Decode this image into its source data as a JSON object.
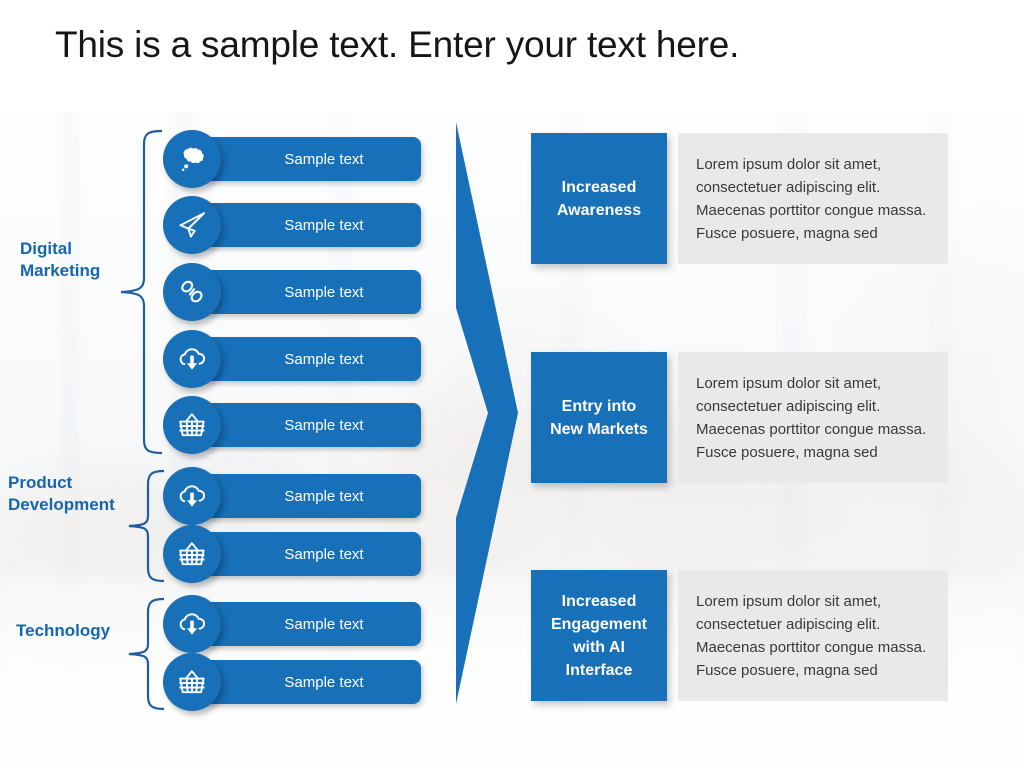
{
  "slide": {
    "title": "This is a sample text. Enter your text here.",
    "accent_blue": "#1770B8",
    "label_blue": "#1566AE",
    "brace_blue": "#1F5E9E",
    "body_gray": "#E9E9E9"
  },
  "categories": [
    {
      "label": "Digital\nMarketing",
      "name": "digital-marketing"
    },
    {
      "label": "Product\nDevelopment",
      "name": "product-development"
    },
    {
      "label": "Technology",
      "name": "technology"
    }
  ],
  "rows": [
    {
      "icon": "thought-cloud-icon",
      "text": "Sample text"
    },
    {
      "icon": "paper-plane-icon",
      "text": "Sample text"
    },
    {
      "icon": "chain-link-icon",
      "text": "Sample text"
    },
    {
      "icon": "cloud-download-icon",
      "text": "Sample text"
    },
    {
      "icon": "shopping-basket-icon",
      "text": "Sample text"
    },
    {
      "icon": "cloud-download-icon",
      "text": "Sample text"
    },
    {
      "icon": "shopping-basket-icon",
      "text": "Sample text"
    },
    {
      "icon": "cloud-download-icon",
      "text": "Sample text"
    },
    {
      "icon": "shopping-basket-icon",
      "text": "Sample text"
    }
  ],
  "outcomes": [
    {
      "heading": "Increased\nAwareness",
      "body": "Lorem ipsum dolor sit amet,\nconsectetuer adipiscing elit.\nMaecenas porttitor congue massa.\nFusce posuere, magna sed"
    },
    {
      "heading": "Entry into\nNew Markets",
      "body": "Lorem ipsum dolor sit amet,\nconsectetuer adipiscing elit.\nMaecenas porttitor congue massa.\nFusce posuere, magna sed"
    },
    {
      "heading": "Increased\nEngagement\nwith AI\nInterface",
      "body": "Lorem ipsum dolor sit amet,\nconsectetuer adipiscing elit.\nMaecenas porttitor congue massa.\nFusce posuere, magna sed"
    }
  ]
}
